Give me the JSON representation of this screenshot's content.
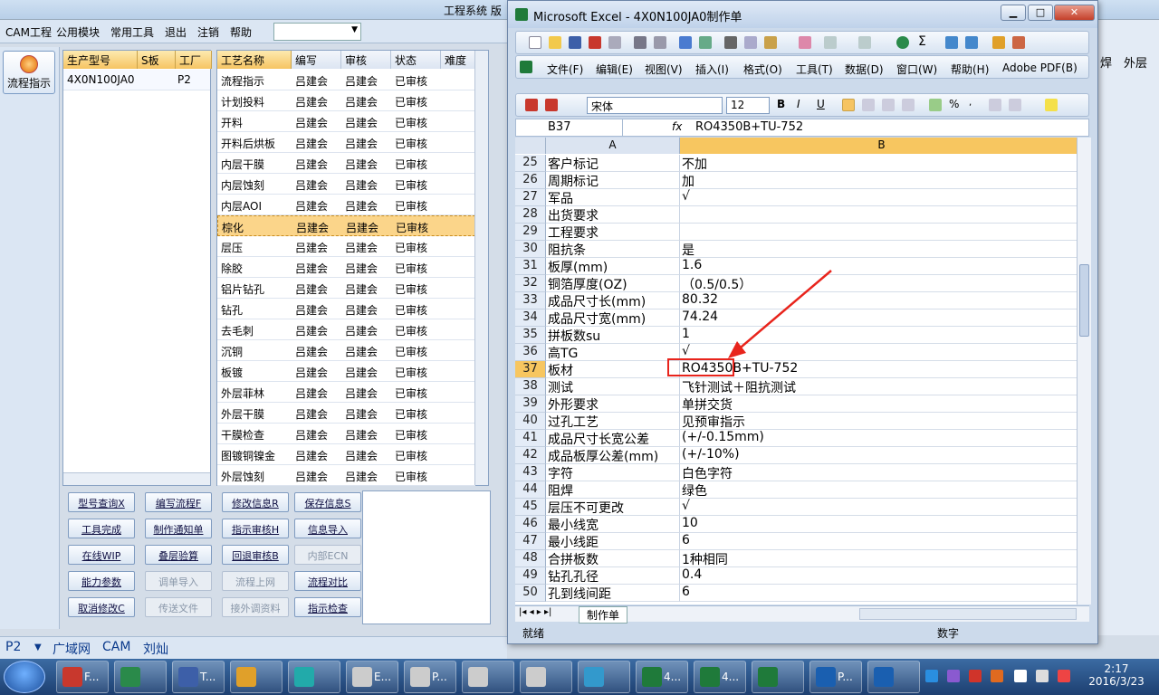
{
  "app": {
    "title": "工程系统  版"
  },
  "menu": {
    "items": [
      "CAM工程",
      "公用模块",
      "常用工具",
      "退出",
      "注销",
      "帮助"
    ],
    "combo_value": ""
  },
  "left": {
    "flow_button": "流程指示"
  },
  "grid1": {
    "headers": [
      "生产型号",
      "S板",
      "工厂"
    ],
    "row": {
      "model": "4X0N100JA0",
      "s": "",
      "factory": "P2"
    }
  },
  "grid2": {
    "headers": [
      "工艺名称",
      "编写",
      "审核",
      "状态",
      "难度"
    ],
    "rows": [
      [
        "流程指示",
        "吕建会",
        "吕建会",
        "已审核"
      ],
      [
        "计划投料",
        "吕建会",
        "吕建会",
        "已审核"
      ],
      [
        "开料",
        "吕建会",
        "吕建会",
        "已审核"
      ],
      [
        "开料后烘板",
        "吕建会",
        "吕建会",
        "已审核"
      ],
      [
        "内层干膜",
        "吕建会",
        "吕建会",
        "已审核"
      ],
      [
        "内层蚀刻",
        "吕建会",
        "吕建会",
        "已审核"
      ],
      [
        "内层AOI",
        "吕建会",
        "吕建会",
        "已审核"
      ],
      [
        "棕化",
        "吕建会",
        "吕建会",
        "已审核"
      ],
      [
        "层压",
        "吕建会",
        "吕建会",
        "已审核"
      ],
      [
        "除胶",
        "吕建会",
        "吕建会",
        "已审核"
      ],
      [
        "铝片钻孔",
        "吕建会",
        "吕建会",
        "已审核"
      ],
      [
        "钻孔",
        "吕建会",
        "吕建会",
        "已审核"
      ],
      [
        "去毛刺",
        "吕建会",
        "吕建会",
        "已审核"
      ],
      [
        "沉铜",
        "吕建会",
        "吕建会",
        "已审核"
      ],
      [
        "板镀",
        "吕建会",
        "吕建会",
        "已审核"
      ],
      [
        "外层菲林",
        "吕建会",
        "吕建会",
        "已审核"
      ],
      [
        "外层干膜",
        "吕建会",
        "吕建会",
        "已审核"
      ],
      [
        "干膜检查",
        "吕建会",
        "吕建会",
        "已审核"
      ],
      [
        "图镀铜镍金",
        "吕建会",
        "吕建会",
        "已审核"
      ],
      [
        "外层蚀刻",
        "吕建会",
        "吕建会",
        "已审核"
      ]
    ],
    "selected_index": 7
  },
  "buttons": [
    [
      "型号查询X",
      "编写流程F",
      "修改信息R",
      "保存信息S"
    ],
    [
      "工具完成",
      "制作通知单",
      "指示审核H",
      "信息导入"
    ],
    [
      "在线WIP",
      "叠层验算",
      "回退审核B",
      "内部ECN"
    ],
    [
      "能力参数",
      "调单导入",
      "流程上网",
      "流程对比"
    ],
    [
      "取消修改C",
      "传送文件",
      "接外调资料",
      "指示检查"
    ]
  ],
  "status": {
    "site": "P2",
    "net": "广域网",
    "mode": "CAM",
    "user": "刘灿"
  },
  "right_strip": {
    "col1": "焊",
    "col2": "外层"
  },
  "excel": {
    "title": "Microsoft Excel - 4X0N100JA0制作单",
    "menus": [
      "文件(F)",
      "编辑(E)",
      "视图(V)",
      "插入(I)",
      "格式(O)",
      "工具(T)",
      "数据(D)",
      "窗口(W)",
      "帮助(H)",
      "Adobe PDF(B)"
    ],
    "font": "宋体",
    "size": "12",
    "cell_ref": "B37",
    "fx": "fx",
    "formula": "RO4350B+TU-752",
    "col_a": "A",
    "col_b": "B",
    "rows": [
      [
        25,
        "客户标记",
        "不加"
      ],
      [
        26,
        "周期标记",
        "加"
      ],
      [
        27,
        "军品",
        "√"
      ],
      [
        28,
        "出货要求",
        ""
      ],
      [
        29,
        "工程要求",
        ""
      ],
      [
        30,
        "阻抗条",
        "是"
      ],
      [
        31,
        "板厚(mm)",
        "1.6"
      ],
      [
        32,
        "铜箔厚度(OZ)",
        "（0.5/0.5）"
      ],
      [
        33,
        "成品尺寸长(mm)",
        "80.32"
      ],
      [
        34,
        "成品尺寸宽(mm)",
        "74.24"
      ],
      [
        35,
        "拼板数su",
        "1"
      ],
      [
        36,
        "高TG",
        "√"
      ],
      [
        37,
        "板材",
        "RO4350B+TU-752"
      ],
      [
        38,
        "测试",
        "飞针测试＋阻抗测试"
      ],
      [
        39,
        "外形要求",
        "单拼交货"
      ],
      [
        40,
        "过孔工艺",
        "见预审指示"
      ],
      [
        41,
        "成品尺寸长宽公差",
        "(+/-0.15mm)"
      ],
      [
        42,
        "成品板厚公差(mm)",
        "(+/-10%)"
      ],
      [
        43,
        "字符",
        "白色字符"
      ],
      [
        44,
        "阻焊",
        "绿色"
      ],
      [
        45,
        "层压不可更改",
        "√"
      ],
      [
        46,
        "最小线宽",
        "10"
      ],
      [
        47,
        "最小线距",
        "6"
      ],
      [
        48,
        "合拼板数",
        "1种相同"
      ],
      [
        49,
        "钻孔孔径",
        "0.4"
      ],
      [
        50,
        "孔到线间距",
        "6"
      ]
    ],
    "selected_row": 37,
    "sheet_tab": "制作单",
    "status_left": "就绪",
    "status_right": "数字"
  },
  "taskbar": {
    "items": [
      "F...",
      "",
      "T...",
      "",
      "",
      "E...",
      "P...",
      "",
      "",
      "",
      "4...",
      "4...",
      "",
      "P...",
      ""
    ],
    "time": "2:17",
    "date": "2016/3/23"
  },
  "colors": {
    "accent": "#f6c462",
    "annotation": "#e8241c",
    "selected_row": "#f7c660"
  }
}
